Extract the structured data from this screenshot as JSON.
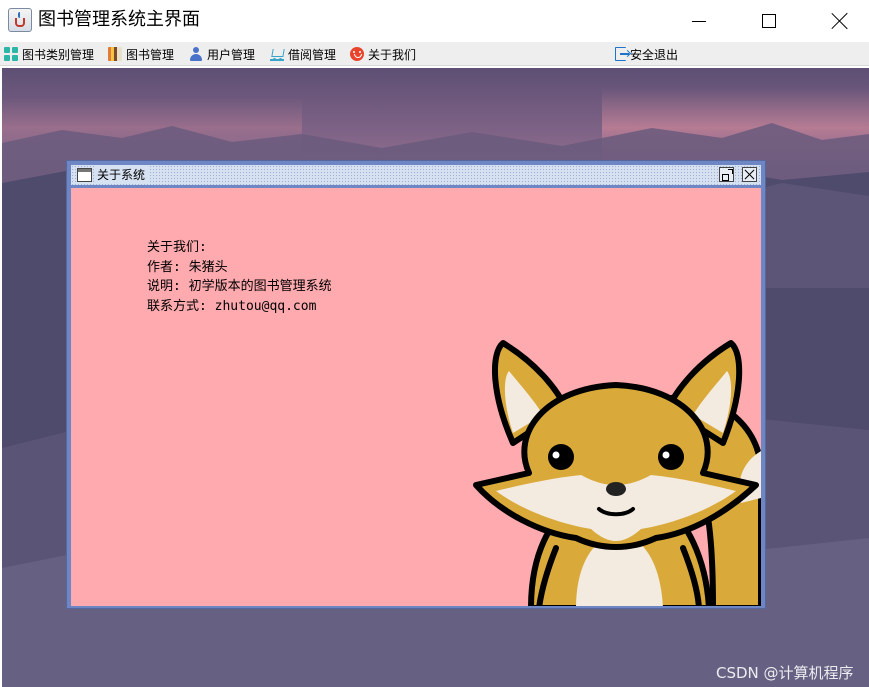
{
  "window": {
    "title": "图书管理系统主界面",
    "icon": "java-cup-icon"
  },
  "menu": {
    "items": [
      {
        "label": "图书类别管理",
        "icon": "grid-icon"
      },
      {
        "label": "图书管理",
        "icon": "books-icon"
      },
      {
        "label": "用户管理",
        "icon": "user-icon"
      },
      {
        "label": "借阅管理",
        "icon": "cart-icon"
      },
      {
        "label": "关于我们",
        "icon": "smile-icon"
      }
    ],
    "logout": {
      "label": "安全退出",
      "icon": "exit-icon"
    }
  },
  "dialog": {
    "title": "关于系统",
    "lines": [
      "关于我们:",
      "作者: 朱猪头",
      "说明: 初学版本的图书管理系统",
      "联系方式: zhutou@qq.com"
    ]
  },
  "watermark": "CSDN @计算机程序",
  "colors": {
    "dialog_bg": "#feaaaf",
    "frame_border": "#6f86c4",
    "fox_body": "#d9a93a",
    "fox_cream": "#f3ebdf"
  }
}
